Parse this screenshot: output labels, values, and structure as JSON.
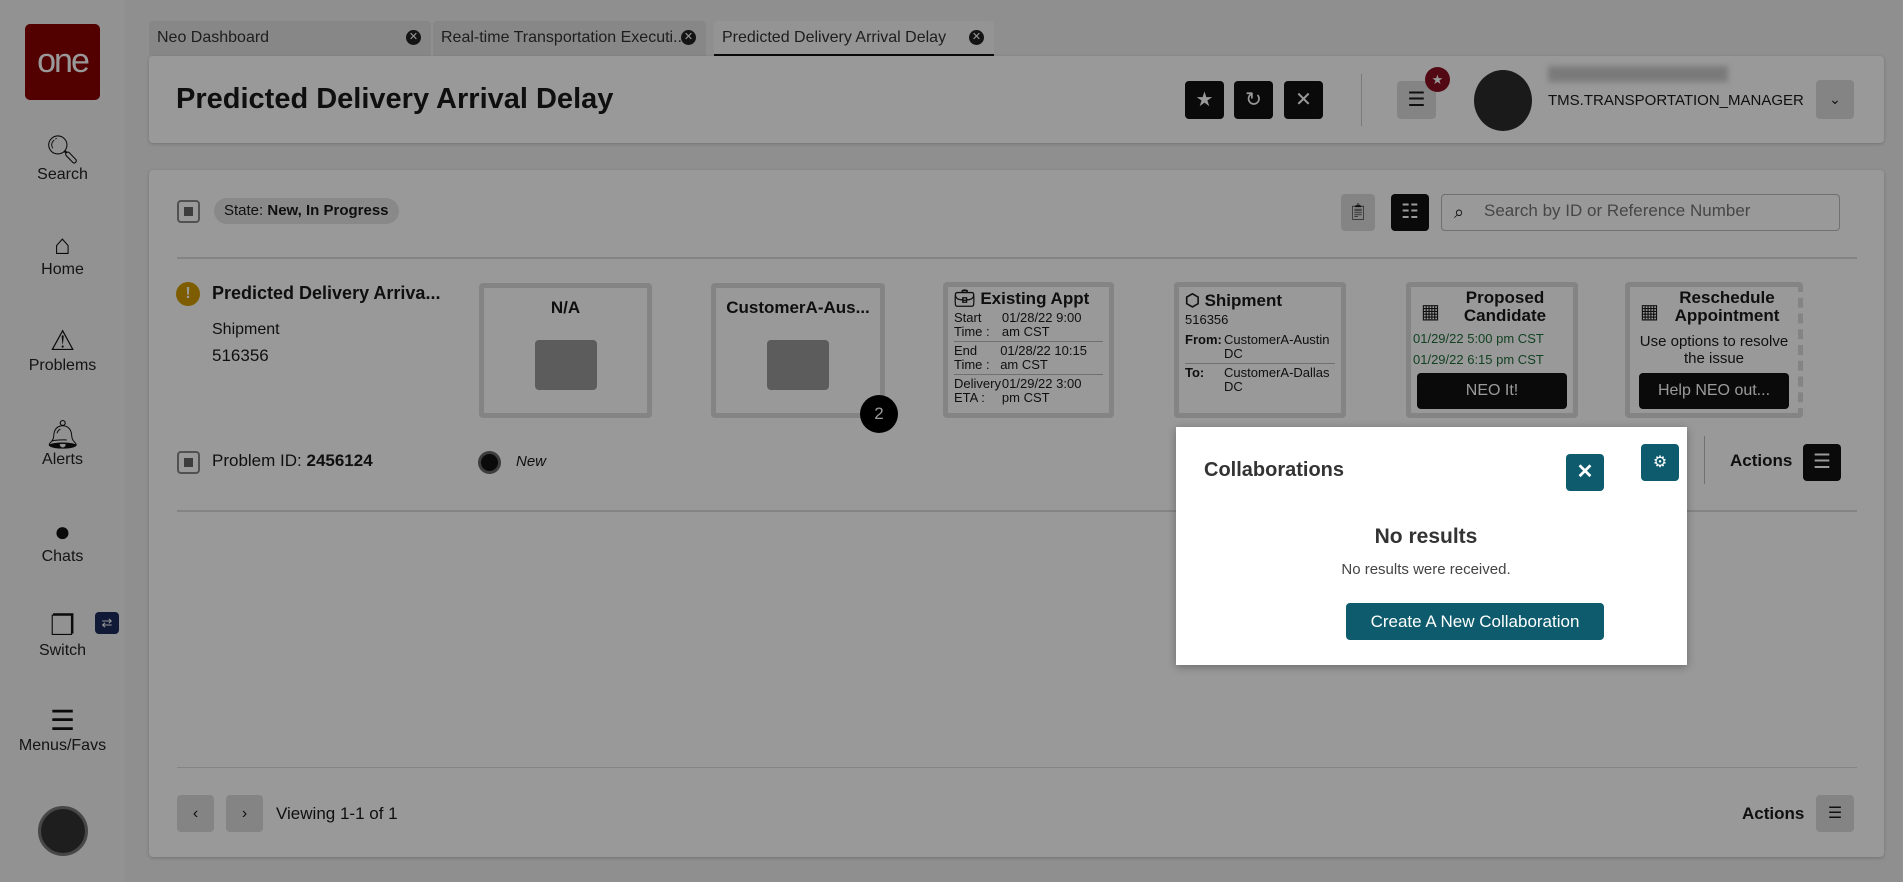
{
  "sidebar": {
    "logo": "one",
    "items": [
      {
        "label": "Search",
        "icon": "search-icon"
      },
      {
        "label": "Home",
        "icon": "home-icon"
      },
      {
        "label": "Problems",
        "icon": "warning-icon"
      },
      {
        "label": "Alerts",
        "icon": "bell-icon"
      },
      {
        "label": "Chats",
        "icon": "chat-icon"
      },
      {
        "label": "Switch",
        "icon": "switch-icon"
      },
      {
        "label": "Menus/Favs",
        "icon": "menu-icon"
      }
    ]
  },
  "tabs": [
    {
      "label": "Neo Dashboard"
    },
    {
      "label": "Real-time Transportation Executi..."
    },
    {
      "label": "Predicted Delivery Arrival Delay",
      "active": true
    }
  ],
  "header": {
    "title": "Predicted Delivery Arrival Delay",
    "username": "TMS.TRANSPORTATION_MANAGER"
  },
  "filter": {
    "state_label": "State:",
    "state_value": "New, In Progress",
    "search_placeholder": "Search by ID or Reference Number"
  },
  "problem": {
    "title": "Predicted Delivery Arriva...",
    "type": "Shipment",
    "id_value": "516356",
    "problem_id_label": "Problem ID:",
    "problem_id": "2456124",
    "status": "New",
    "cards": {
      "na": "N/A",
      "customer": "CustomerA-Aus...",
      "badge": "2",
      "existing": {
        "title": "Existing Appt",
        "rows": [
          [
            "Start Time :",
            "01/28/22 9:00 am CST"
          ],
          [
            "End Time :",
            "01/28/22 10:15 am CST"
          ],
          [
            "Delivery ETA :",
            "01/29/22 3:00 pm CST"
          ]
        ]
      },
      "shipment": {
        "title": "Shipment",
        "id": "516356",
        "from_label": "From:",
        "from": "CustomerA-Austin DC",
        "to_label": "To:",
        "to": "CustomerA-Dallas DC"
      },
      "proposed": {
        "title": "Proposed Candidate",
        "times": [
          "01/29/22 5:00 pm CST",
          "01/29/22 6:15 pm CST"
        ],
        "button": "NEO It!"
      },
      "reschedule": {
        "title": "Reschedule Appointment",
        "text": "Use options to resolve the issue",
        "button": "Help NEO out..."
      }
    },
    "actions": "Actions"
  },
  "footer": {
    "viewing": "Viewing 1-1 of 1",
    "actions": "Actions"
  },
  "popup": {
    "title": "Collaborations",
    "empty_title": "No results",
    "empty_text": "No results were received.",
    "create_button": "Create A New Collaboration"
  },
  "colors": {
    "teal": "#0d5b6d",
    "logo": "#8a0000"
  }
}
